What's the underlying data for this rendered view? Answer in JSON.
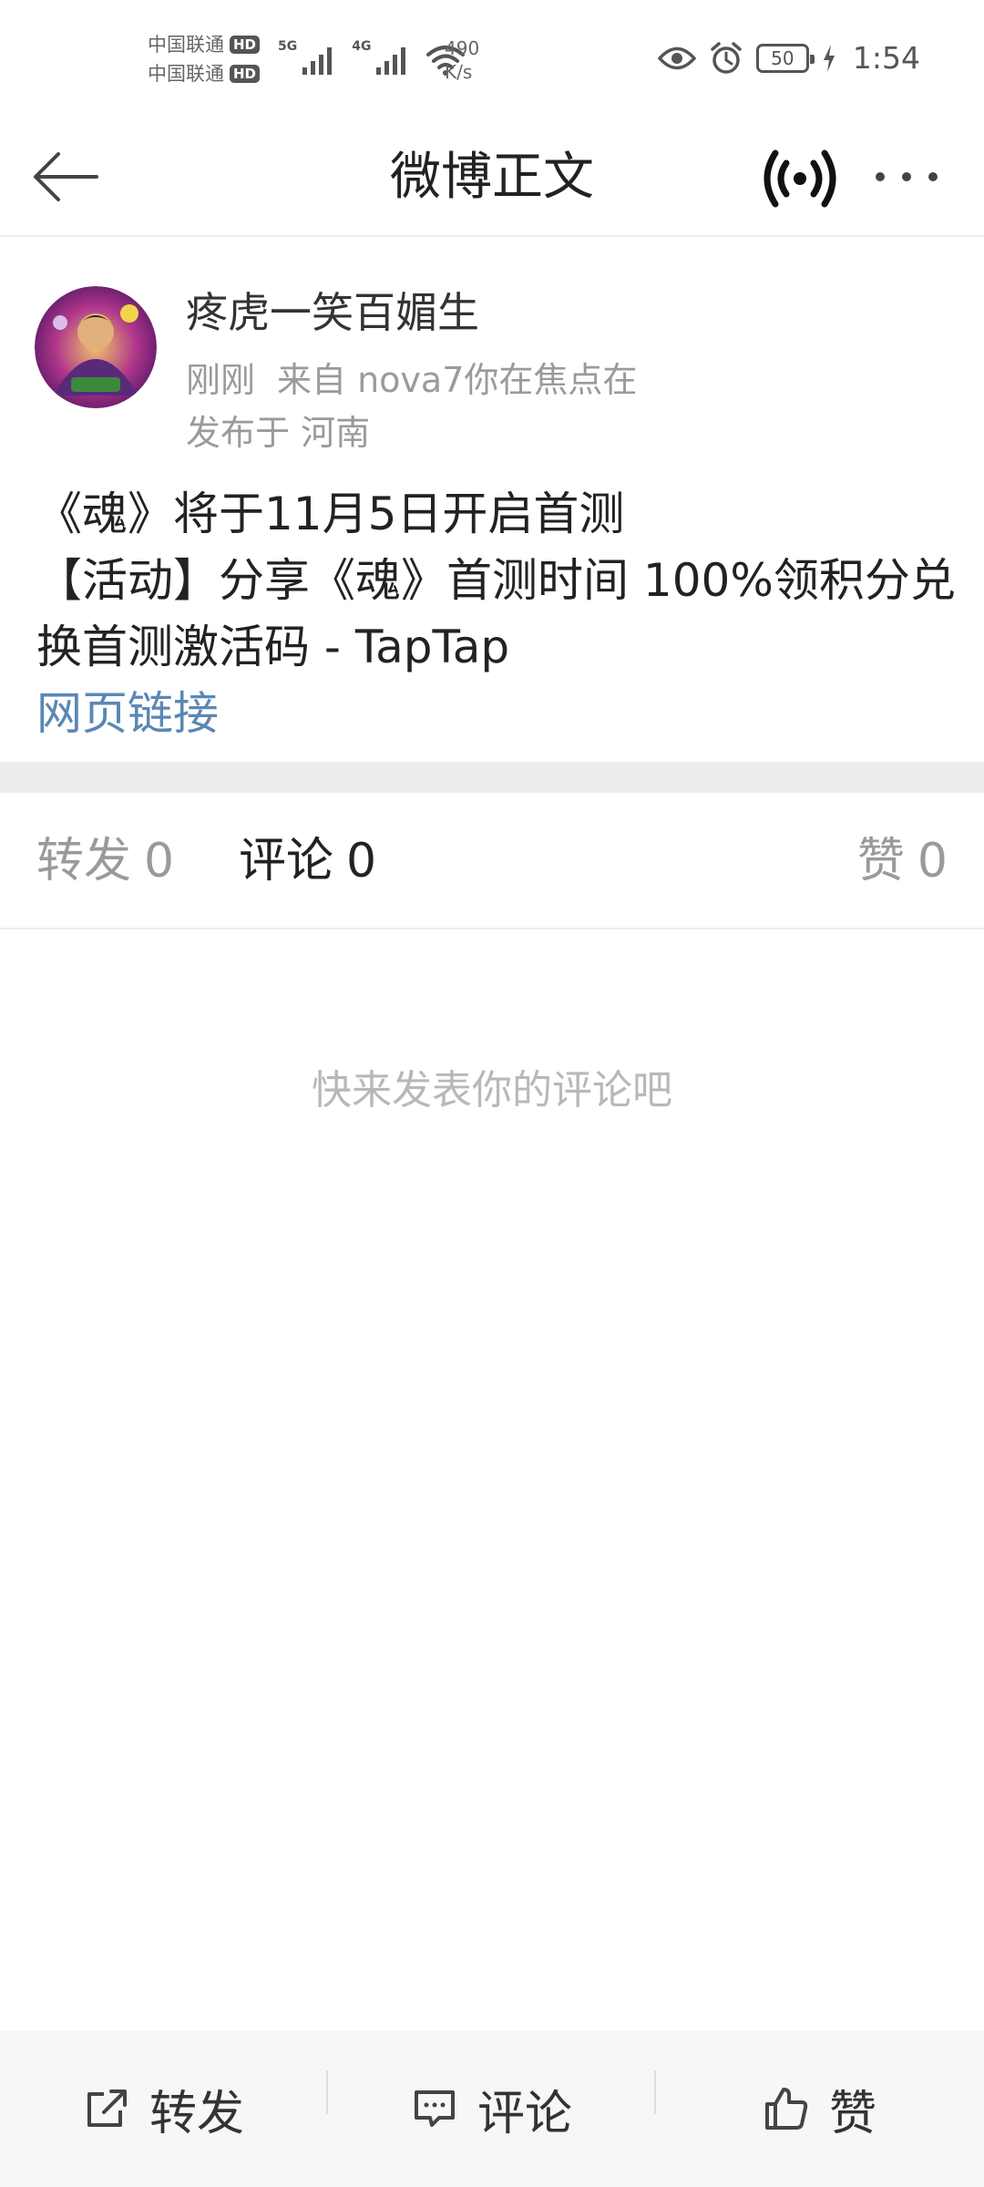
{
  "status_bar": {
    "carrier_1": "中国联通",
    "carrier_2": "中国联通",
    "hd_badge": "HD",
    "network_1": "5G",
    "network_2": "4G",
    "speed_value": "490",
    "speed_unit": "K/s",
    "battery": "50",
    "time": "1:54"
  },
  "header": {
    "title": "微博正文"
  },
  "post": {
    "username": "疼虎一笑百媚生",
    "time": "刚刚",
    "source": "来自 nova7你在焦点在",
    "location": "发布于 河南",
    "line_1": "《魂》将于11月5日开启首测",
    "line_2": "【活动】分享《魂》首测时间 100%领积分兑换首测激活码 - TapTap",
    "link_label": "网页链接"
  },
  "tabs": {
    "repost_label": "转发",
    "repost_count": "0",
    "comment_label": "评论",
    "comment_count": "0",
    "like_label": "赞",
    "like_count": "0"
  },
  "empty_hint": "快来发表你的评论吧",
  "bottom_bar": {
    "repost_label": "转发",
    "comment_label": "评论",
    "like_label": "赞"
  },
  "colors": {
    "link": "#5b87b5",
    "muted_text": "#9a9a9a",
    "divider_band": "#ededed"
  }
}
